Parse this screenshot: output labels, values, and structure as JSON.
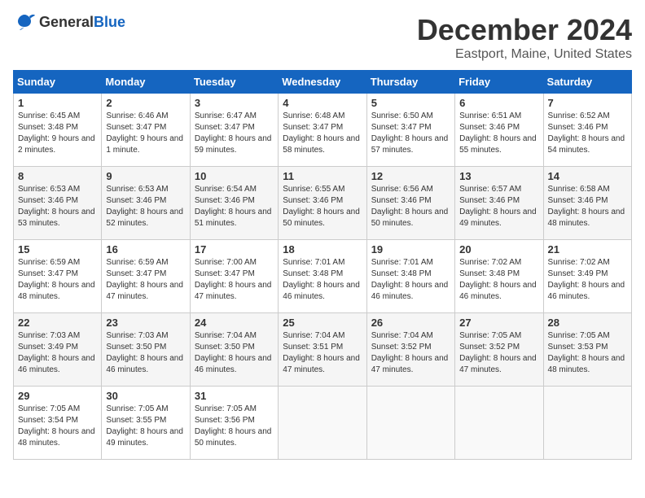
{
  "header": {
    "logo_general": "General",
    "logo_blue": "Blue",
    "month": "December 2024",
    "location": "Eastport, Maine, United States"
  },
  "days_of_week": [
    "Sunday",
    "Monday",
    "Tuesday",
    "Wednesday",
    "Thursday",
    "Friday",
    "Saturday"
  ],
  "weeks": [
    [
      {
        "day": 1,
        "rise": "6:45 AM",
        "set": "3:48 PM",
        "daylight": "9 hours and 2 minutes."
      },
      {
        "day": 2,
        "rise": "6:46 AM",
        "set": "3:47 PM",
        "daylight": "9 hours and 1 minute."
      },
      {
        "day": 3,
        "rise": "6:47 AM",
        "set": "3:47 PM",
        "daylight": "8 hours and 59 minutes."
      },
      {
        "day": 4,
        "rise": "6:48 AM",
        "set": "3:47 PM",
        "daylight": "8 hours and 58 minutes."
      },
      {
        "day": 5,
        "rise": "6:50 AM",
        "set": "3:47 PM",
        "daylight": "8 hours and 57 minutes."
      },
      {
        "day": 6,
        "rise": "6:51 AM",
        "set": "3:46 PM",
        "daylight": "8 hours and 55 minutes."
      },
      {
        "day": 7,
        "rise": "6:52 AM",
        "set": "3:46 PM",
        "daylight": "8 hours and 54 minutes."
      }
    ],
    [
      {
        "day": 8,
        "rise": "6:53 AM",
        "set": "3:46 PM",
        "daylight": "8 hours and 53 minutes."
      },
      {
        "day": 9,
        "rise": "6:53 AM",
        "set": "3:46 PM",
        "daylight": "8 hours and 52 minutes."
      },
      {
        "day": 10,
        "rise": "6:54 AM",
        "set": "3:46 PM",
        "daylight": "8 hours and 51 minutes."
      },
      {
        "day": 11,
        "rise": "6:55 AM",
        "set": "3:46 PM",
        "daylight": "8 hours and 50 minutes."
      },
      {
        "day": 12,
        "rise": "6:56 AM",
        "set": "3:46 PM",
        "daylight": "8 hours and 50 minutes."
      },
      {
        "day": 13,
        "rise": "6:57 AM",
        "set": "3:46 PM",
        "daylight": "8 hours and 49 minutes."
      },
      {
        "day": 14,
        "rise": "6:58 AM",
        "set": "3:46 PM",
        "daylight": "8 hours and 48 minutes."
      }
    ],
    [
      {
        "day": 15,
        "rise": "6:59 AM",
        "set": "3:47 PM",
        "daylight": "8 hours and 48 minutes."
      },
      {
        "day": 16,
        "rise": "6:59 AM",
        "set": "3:47 PM",
        "daylight": "8 hours and 47 minutes."
      },
      {
        "day": 17,
        "rise": "7:00 AM",
        "set": "3:47 PM",
        "daylight": "8 hours and 47 minutes."
      },
      {
        "day": 18,
        "rise": "7:01 AM",
        "set": "3:48 PM",
        "daylight": "8 hours and 46 minutes."
      },
      {
        "day": 19,
        "rise": "7:01 AM",
        "set": "3:48 PM",
        "daylight": "8 hours and 46 minutes."
      },
      {
        "day": 20,
        "rise": "7:02 AM",
        "set": "3:48 PM",
        "daylight": "8 hours and 46 minutes."
      },
      {
        "day": 21,
        "rise": "7:02 AM",
        "set": "3:49 PM",
        "daylight": "8 hours and 46 minutes."
      }
    ],
    [
      {
        "day": 22,
        "rise": "7:03 AM",
        "set": "3:49 PM",
        "daylight": "8 hours and 46 minutes."
      },
      {
        "day": 23,
        "rise": "7:03 AM",
        "set": "3:50 PM",
        "daylight": "8 hours and 46 minutes."
      },
      {
        "day": 24,
        "rise": "7:04 AM",
        "set": "3:50 PM",
        "daylight": "8 hours and 46 minutes."
      },
      {
        "day": 25,
        "rise": "7:04 AM",
        "set": "3:51 PM",
        "daylight": "8 hours and 47 minutes."
      },
      {
        "day": 26,
        "rise": "7:04 AM",
        "set": "3:52 PM",
        "daylight": "8 hours and 47 minutes."
      },
      {
        "day": 27,
        "rise": "7:05 AM",
        "set": "3:52 PM",
        "daylight": "8 hours and 47 minutes."
      },
      {
        "day": 28,
        "rise": "7:05 AM",
        "set": "3:53 PM",
        "daylight": "8 hours and 48 minutes."
      }
    ],
    [
      {
        "day": 29,
        "rise": "7:05 AM",
        "set": "3:54 PM",
        "daylight": "8 hours and 48 minutes."
      },
      {
        "day": 30,
        "rise": "7:05 AM",
        "set": "3:55 PM",
        "daylight": "8 hours and 49 minutes."
      },
      {
        "day": 31,
        "rise": "7:05 AM",
        "set": "3:56 PM",
        "daylight": "8 hours and 50 minutes."
      },
      null,
      null,
      null,
      null
    ]
  ]
}
